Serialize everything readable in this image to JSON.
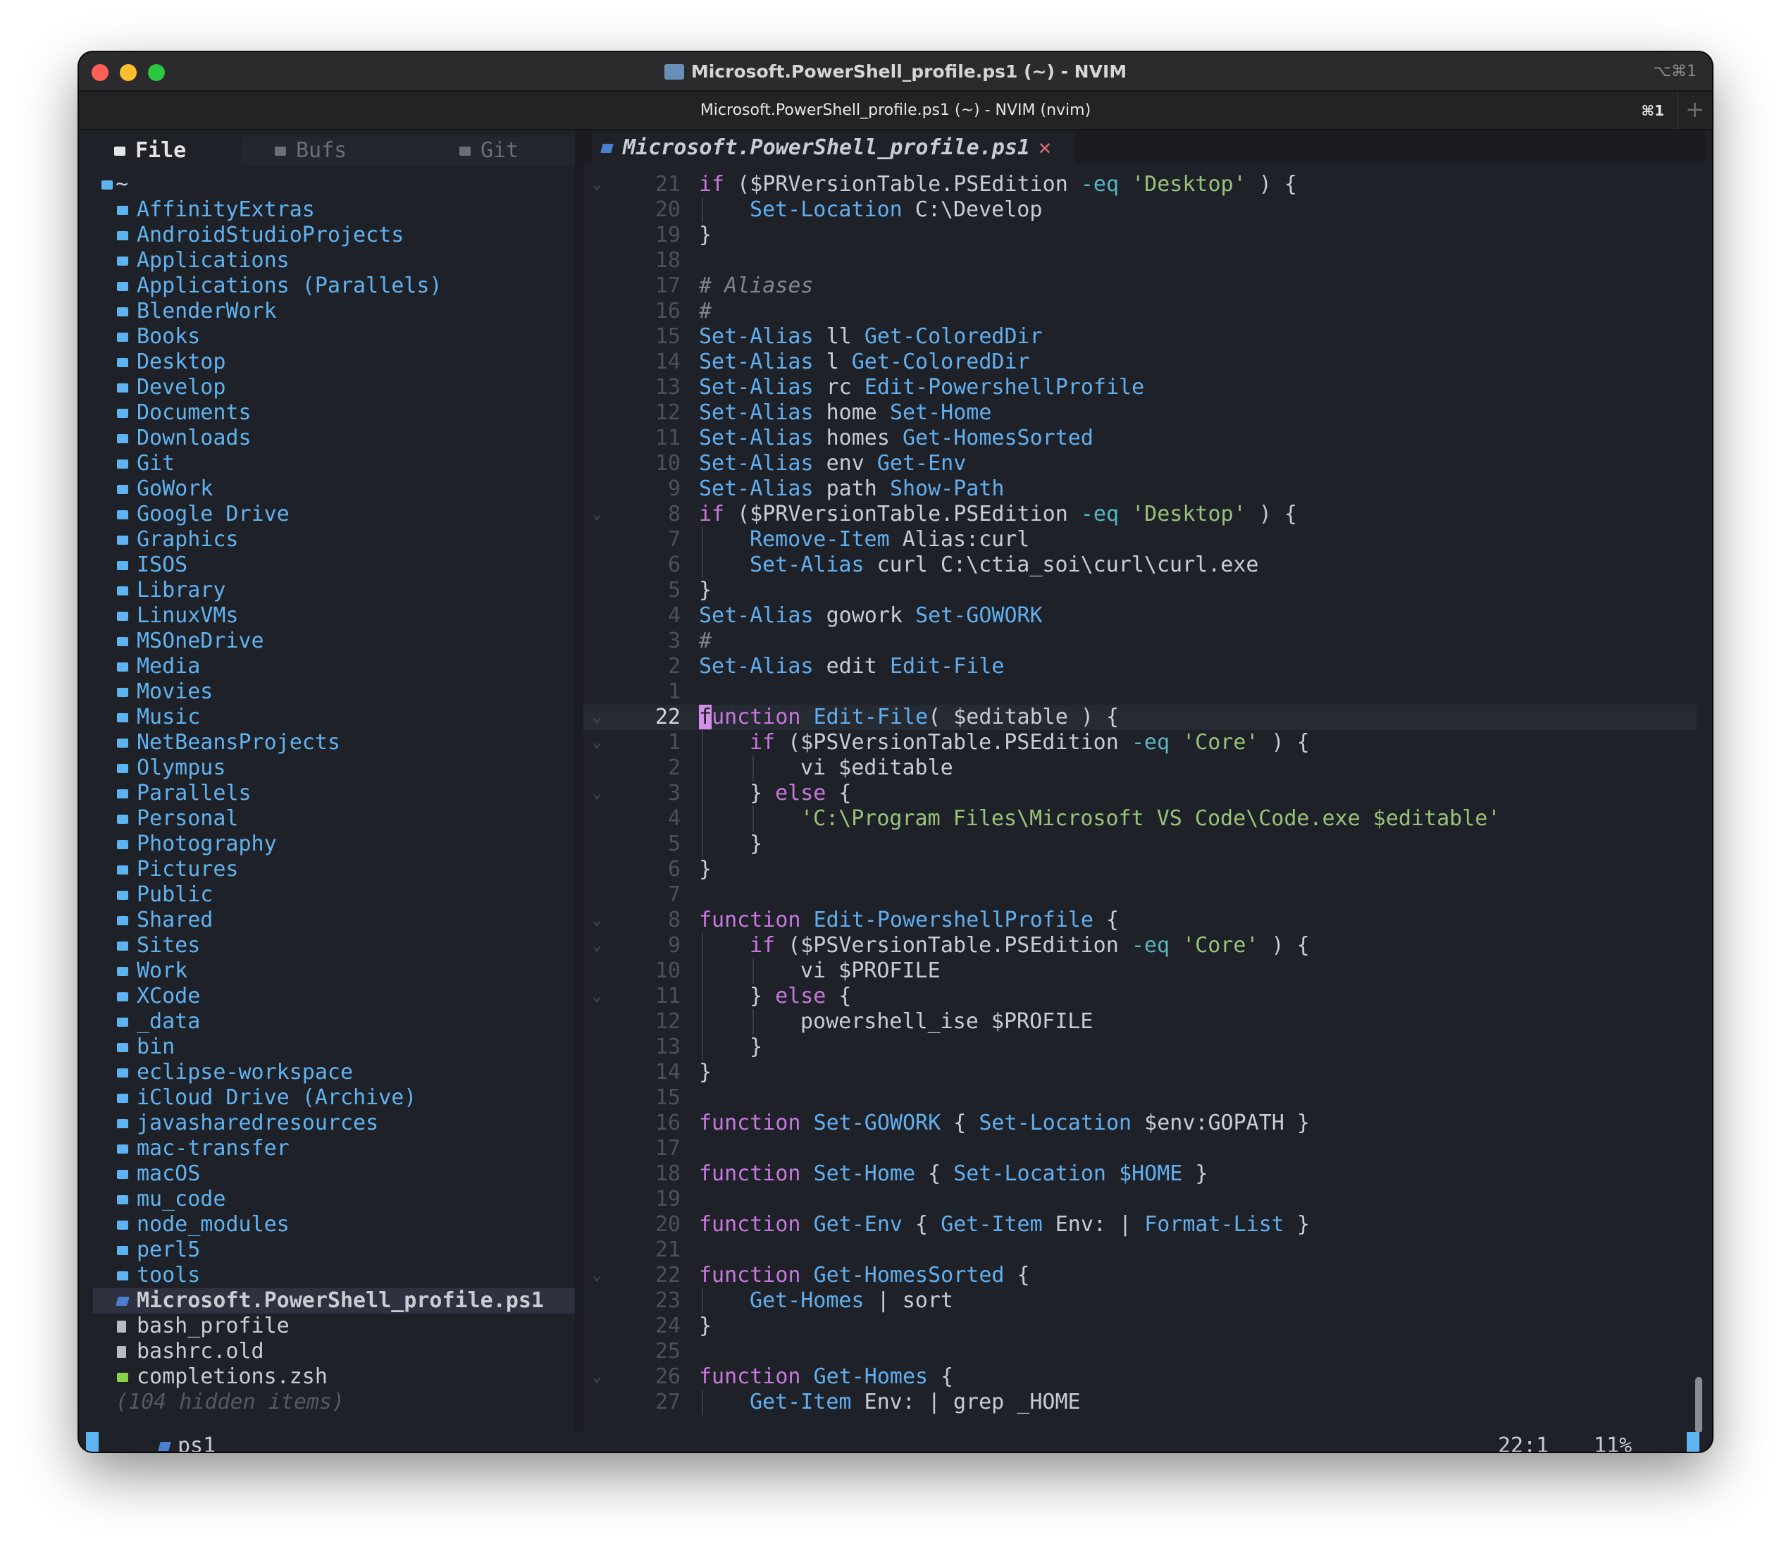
{
  "window": {
    "title": "Microsoft.PowerShell_profile.ps1 (~) - NVIM",
    "shortcut": "⌥⌘1"
  },
  "tab": {
    "title": "Microsoft.PowerShell_profile.ps1 (~) - NVIM (nvim)",
    "shortcut": "⌘1",
    "add_label": "+"
  },
  "sidebar": {
    "tabs": [
      {
        "label": "File"
      },
      {
        "label": "Bufs"
      },
      {
        "label": "Git"
      }
    ],
    "root": "~",
    "dirs": [
      "AffinityExtras",
      "AndroidStudioProjects",
      "Applications",
      "Applications (Parallels)",
      "BlenderWork",
      "Books",
      "Desktop",
      "Develop",
      "Documents",
      "Downloads",
      "Git",
      "GoWork",
      "Google Drive",
      "Graphics",
      "ISOS",
      "Library",
      "LinuxVMs",
      "MSOneDrive",
      "Media",
      "Movies",
      "Music",
      "NetBeansProjects",
      "Olympus",
      "Parallels",
      "Personal",
      "Photography",
      "Pictures",
      "Public",
      "Shared",
      "Sites",
      "Work",
      "XCode",
      "_data",
      "bin",
      "eclipse-workspace",
      "iCloud Drive (Archive)",
      "javasharedresources",
      "mac-transfer",
      "macOS",
      "mu_code",
      "node_modules",
      "perl5",
      "tools"
    ],
    "selected_file": "Microsoft.PowerShell_profile.ps1",
    "files": [
      "bash_profile",
      "bashrc.old",
      "completions.zsh"
    ],
    "hidden_note": "(104 hidden items)"
  },
  "editor": {
    "tab_label": "Microsoft.PowerShell_profile.ps1",
    "tab_close": "✕",
    "lines": [
      {
        "n": "21",
        "fold": "⌄",
        "indent": 0,
        "tokens": [
          [
            "kw",
            "if"
          ],
          [
            "plain",
            " ($PRVersionTable.PSEdition "
          ],
          [
            "op",
            "-eq"
          ],
          [
            "plain",
            " "
          ],
          [
            "str",
            "'Desktop'"
          ],
          [
            "plain",
            " ) {"
          ]
        ]
      },
      {
        "n": "20",
        "indent": 1,
        "tokens": [
          [
            "cmd",
            "Set-Location"
          ],
          [
            "plain",
            " C:\\Develop"
          ]
        ]
      },
      {
        "n": "19",
        "indent": 0,
        "tokens": [
          [
            "plain",
            "}"
          ]
        ]
      },
      {
        "n": "18",
        "indent": 0,
        "tokens": []
      },
      {
        "n": "17",
        "indent": 0,
        "tokens": [
          [
            "cmt",
            "# Aliases"
          ]
        ]
      },
      {
        "n": "16",
        "indent": 0,
        "tokens": [
          [
            "cmt",
            "#"
          ]
        ]
      },
      {
        "n": "15",
        "indent": 0,
        "tokens": [
          [
            "cmd",
            "Set-Alias"
          ],
          [
            "plain",
            " ll "
          ],
          [
            "cmd",
            "Get-ColoredDir"
          ]
        ]
      },
      {
        "n": "14",
        "indent": 0,
        "tokens": [
          [
            "cmd",
            "Set-Alias"
          ],
          [
            "plain",
            " l "
          ],
          [
            "cmd",
            "Get-ColoredDir"
          ]
        ]
      },
      {
        "n": "13",
        "indent": 0,
        "tokens": [
          [
            "cmd",
            "Set-Alias"
          ],
          [
            "plain",
            " rc "
          ],
          [
            "cmd",
            "Edit-PowershellProfile"
          ]
        ]
      },
      {
        "n": "12",
        "indent": 0,
        "tokens": [
          [
            "cmd",
            "Set-Alias"
          ],
          [
            "plain",
            " home "
          ],
          [
            "cmd",
            "Set-Home"
          ]
        ]
      },
      {
        "n": "11",
        "indent": 0,
        "tokens": [
          [
            "cmd",
            "Set-Alias"
          ],
          [
            "plain",
            " homes "
          ],
          [
            "cmd",
            "Get-HomesSorted"
          ]
        ]
      },
      {
        "n": "10",
        "indent": 0,
        "tokens": [
          [
            "cmd",
            "Set-Alias"
          ],
          [
            "plain",
            " env "
          ],
          [
            "cmd",
            "Get-Env"
          ]
        ]
      },
      {
        "n": "9",
        "indent": 0,
        "tokens": [
          [
            "cmd",
            "Set-Alias"
          ],
          [
            "plain",
            " path "
          ],
          [
            "cmd",
            "Show-Path"
          ]
        ]
      },
      {
        "n": "8",
        "fold": "⌄",
        "indent": 0,
        "tokens": [
          [
            "kw",
            "if"
          ],
          [
            "plain",
            " ($PRVersionTable.PSEdition "
          ],
          [
            "op",
            "-eq"
          ],
          [
            "plain",
            " "
          ],
          [
            "str",
            "'Desktop'"
          ],
          [
            "plain",
            " ) {"
          ]
        ]
      },
      {
        "n": "7",
        "indent": 1,
        "tokens": [
          [
            "cmd",
            "Remove-Item"
          ],
          [
            "plain",
            " Alias:curl"
          ]
        ]
      },
      {
        "n": "6",
        "indent": 1,
        "tokens": [
          [
            "cmd",
            "Set-Alias"
          ],
          [
            "plain",
            " curl C:\\ctia_soi\\curl\\curl.exe"
          ]
        ]
      },
      {
        "n": "5",
        "indent": 0,
        "tokens": [
          [
            "plain",
            "}"
          ]
        ]
      },
      {
        "n": "4",
        "indent": 0,
        "tokens": [
          [
            "cmd",
            "Set-Alias"
          ],
          [
            "plain",
            " gowork "
          ],
          [
            "cmd",
            "Set-GOWORK"
          ]
        ]
      },
      {
        "n": "3",
        "indent": 0,
        "tokens": [
          [
            "cmt",
            "#"
          ]
        ]
      },
      {
        "n": "2",
        "indent": 0,
        "tokens": [
          [
            "cmd",
            "Set-Alias"
          ],
          [
            "plain",
            " edit "
          ],
          [
            "cmd",
            "Edit-File"
          ]
        ]
      },
      {
        "n": "1",
        "indent": 0,
        "tokens": []
      },
      {
        "n": "22",
        "fold": "⌄",
        "indent": 0,
        "current": true,
        "tokens": [
          [
            "cursor",
            "f"
          ],
          [
            "kw",
            "unction"
          ],
          [
            "plain",
            " "
          ],
          [
            "cmd",
            "Edit-File"
          ],
          [
            "plain",
            "( $editable ) {"
          ]
        ]
      },
      {
        "n": "1",
        "fold": "⌄",
        "indent": 1,
        "tokens": [
          [
            "kw",
            "if"
          ],
          [
            "plain",
            " ($PSVersionTable.PSEdition "
          ],
          [
            "op",
            "-eq"
          ],
          [
            "plain",
            " "
          ],
          [
            "str",
            "'Core'"
          ],
          [
            "plain",
            " ) {"
          ]
        ]
      },
      {
        "n": "2",
        "indent": 2,
        "tokens": [
          [
            "plain",
            "vi $editable"
          ]
        ]
      },
      {
        "n": "3",
        "fold": "⌄",
        "indent": 1,
        "tokens": [
          [
            "plain",
            "} "
          ],
          [
            "kw",
            "else"
          ],
          [
            "plain",
            " {"
          ]
        ]
      },
      {
        "n": "4",
        "indent": 2,
        "tokens": [
          [
            "str",
            "'C:\\Program Files\\Microsoft VS Code\\Code.exe $editable'"
          ]
        ]
      },
      {
        "n": "5",
        "indent": 1,
        "tokens": [
          [
            "plain",
            "}"
          ]
        ]
      },
      {
        "n": "6",
        "indent": 0,
        "tokens": [
          [
            "plain",
            "}"
          ]
        ]
      },
      {
        "n": "7",
        "indent": 0,
        "tokens": []
      },
      {
        "n": "8",
        "fold": "⌄",
        "indent": 0,
        "tokens": [
          [
            "kw",
            "function"
          ],
          [
            "plain",
            " "
          ],
          [
            "cmd",
            "Edit-PowershellProfile"
          ],
          [
            "plain",
            " {"
          ]
        ]
      },
      {
        "n": "9",
        "fold": "⌄",
        "indent": 1,
        "tokens": [
          [
            "kw",
            "if"
          ],
          [
            "plain",
            " ($PSVersionTable.PSEdition "
          ],
          [
            "op",
            "-eq"
          ],
          [
            "plain",
            " "
          ],
          [
            "str",
            "'Core'"
          ],
          [
            "plain",
            " ) {"
          ]
        ]
      },
      {
        "n": "10",
        "indent": 2,
        "tokens": [
          [
            "plain",
            "vi $PROFILE"
          ]
        ]
      },
      {
        "n": "11",
        "fold": "⌄",
        "indent": 1,
        "tokens": [
          [
            "plain",
            "} "
          ],
          [
            "kw",
            "else"
          ],
          [
            "plain",
            " {"
          ]
        ]
      },
      {
        "n": "12",
        "indent": 2,
        "tokens": [
          [
            "plain",
            "powershell_ise $PROFILE"
          ]
        ]
      },
      {
        "n": "13",
        "indent": 1,
        "tokens": [
          [
            "plain",
            "}"
          ]
        ]
      },
      {
        "n": "14",
        "indent": 0,
        "tokens": [
          [
            "plain",
            "}"
          ]
        ]
      },
      {
        "n": "15",
        "indent": 0,
        "tokens": []
      },
      {
        "n": "16",
        "indent": 0,
        "tokens": [
          [
            "kw",
            "function"
          ],
          [
            "plain",
            " "
          ],
          [
            "cmd",
            "Set-GOWORK"
          ],
          [
            "plain",
            " { "
          ],
          [
            "cmd",
            "Set-Location"
          ],
          [
            "plain",
            " $env:GOPATH }"
          ]
        ]
      },
      {
        "n": "17",
        "indent": 0,
        "tokens": []
      },
      {
        "n": "18",
        "indent": 0,
        "tokens": [
          [
            "kw",
            "function"
          ],
          [
            "plain",
            " "
          ],
          [
            "cmd",
            "Set-Home"
          ],
          [
            "plain",
            " { "
          ],
          [
            "cmd",
            "Set-Location"
          ],
          [
            "plain",
            " "
          ],
          [
            "cmd",
            "$HOME"
          ],
          [
            "plain",
            " }"
          ]
        ]
      },
      {
        "n": "19",
        "indent": 0,
        "tokens": []
      },
      {
        "n": "20",
        "indent": 0,
        "tokens": [
          [
            "kw",
            "function"
          ],
          [
            "plain",
            " "
          ],
          [
            "cmd",
            "Get-Env"
          ],
          [
            "plain",
            " { "
          ],
          [
            "cmd",
            "Get-Item"
          ],
          [
            "plain",
            " Env: | "
          ],
          [
            "cmd",
            "Format-List"
          ],
          [
            "plain",
            " }"
          ]
        ]
      },
      {
        "n": "21",
        "indent": 0,
        "tokens": []
      },
      {
        "n": "22",
        "fold": "⌄",
        "indent": 0,
        "tokens": [
          [
            "kw",
            "function"
          ],
          [
            "plain",
            " "
          ],
          [
            "cmd",
            "Get-HomesSorted"
          ],
          [
            "plain",
            " {"
          ]
        ]
      },
      {
        "n": "23",
        "indent": 1,
        "tokens": [
          [
            "cmd",
            "Get-Homes"
          ],
          [
            "plain",
            " | sort"
          ]
        ]
      },
      {
        "n": "24",
        "indent": 0,
        "tokens": [
          [
            "plain",
            "}"
          ]
        ]
      },
      {
        "n": "25",
        "indent": 0,
        "tokens": []
      },
      {
        "n": "26",
        "fold": "⌄",
        "indent": 0,
        "tokens": [
          [
            "kw",
            "function"
          ],
          [
            "plain",
            " "
          ],
          [
            "cmd",
            "Get-Homes"
          ],
          [
            "plain",
            " {"
          ]
        ]
      },
      {
        "n": "27",
        "indent": 1,
        "tokens": [
          [
            "cmd",
            "Get-Item"
          ],
          [
            "plain",
            " Env: | grep _HOME"
          ]
        ]
      }
    ]
  },
  "statusline": {
    "filetype": "ps1",
    "position": "22:1",
    "percent": "11%"
  },
  "colors": {
    "background": "#1f2128",
    "directory": "#5fb3f0",
    "keyword": "#c678dd",
    "command": "#61afef",
    "string": "#98c379",
    "accent": "#e5a33a"
  }
}
